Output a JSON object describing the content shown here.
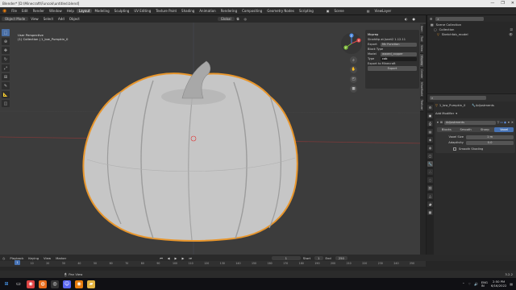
{
  "window": {
    "title": "Blender* [D:\\Minecraft\\Funcok\\untitled.blend]",
    "controls": [
      "—",
      "❐",
      "✕"
    ]
  },
  "menu": {
    "items": [
      "File",
      "Edit",
      "Render",
      "Window",
      "Help"
    ],
    "workspaces": [
      "Layout",
      "Modeling",
      "Sculpting",
      "UV Editing",
      "Texture Paint",
      "Shading",
      "Animation",
      "Rendering",
      "Compositing",
      "Geometry Nodes",
      "Scripting"
    ],
    "active_workspace": "Layout",
    "scene_label": "Scene",
    "viewlayer_label": "ViewLayer"
  },
  "header3d": {
    "mode": "Object Mode",
    "menus": [
      "View",
      "Select",
      "Add",
      "Object"
    ],
    "orientation": "Global"
  },
  "viewport": {
    "perspective_label": "User Perspective",
    "collection_label": "(1) Collection | 1_low_Pumpkin_0",
    "gizmo_axes": [
      "X",
      "Y",
      "Z"
    ],
    "bg_color": "#3c3c3c",
    "mesh_color": "#c8c8c8",
    "outline_color": "#e8962c"
  },
  "npanel": {
    "title": "Mcprep",
    "version": "Sinahttp at Jsnet2 1.12.11",
    "export_label": "Export",
    "export_value": "Mc Function",
    "block_type_label": "Block Type",
    "model_label": "Model",
    "model_value": "waxed_copper",
    "type_label": "Type",
    "type_value": "cob",
    "note": "Export to Minecraft",
    "export_button": "Export"
  },
  "ntabs": [
    "Item",
    "Tool",
    "View",
    "Mcprep",
    "Create",
    "MineWorld",
    "Texture"
  ],
  "outliner": {
    "header": "Scene Collection",
    "items": [
      {
        "label": "Collection",
        "icon": "collection-icon"
      },
      {
        "label": "Sketchfab_model",
        "icon": "object-icon"
      }
    ]
  },
  "properties": {
    "object_name": "1_low_Pumpkin_0",
    "modifier_tab": "Adjustments",
    "add_modifier": "Add Modifier",
    "modifier_name": "Adjustments",
    "modes": [
      "Blocks",
      "Smooth",
      "Sharp",
      "Voxel"
    ],
    "active_mode": "Voxel",
    "voxel_size_label": "Voxel Size",
    "voxel_size_value": "1 m",
    "adaptivity_label": "Adaptivity",
    "adaptivity_value": "0.0",
    "smooth_shading_label": "Smooth Shading"
  },
  "timeline": {
    "menus": [
      "Playback",
      "Keying",
      "View",
      "Marker"
    ],
    "current_frame": "1",
    "start_label": "Start",
    "start_value": "1",
    "end_label": "End",
    "end_value": "250",
    "ruler": [
      "1",
      "10",
      "20",
      "30",
      "40",
      "50",
      "60",
      "70",
      "80",
      "90",
      "100",
      "110",
      "120",
      "130",
      "140",
      "150",
      "160",
      "170",
      "180",
      "190",
      "200",
      "210",
      "220",
      "230",
      "240",
      "250"
    ]
  },
  "statusbar": {
    "text": "Pan View",
    "version": "3.2.2"
  },
  "taskbar": {
    "lang": "ENG",
    "region": "IN",
    "time": "2:50 PM",
    "date": "6/16/2022"
  }
}
